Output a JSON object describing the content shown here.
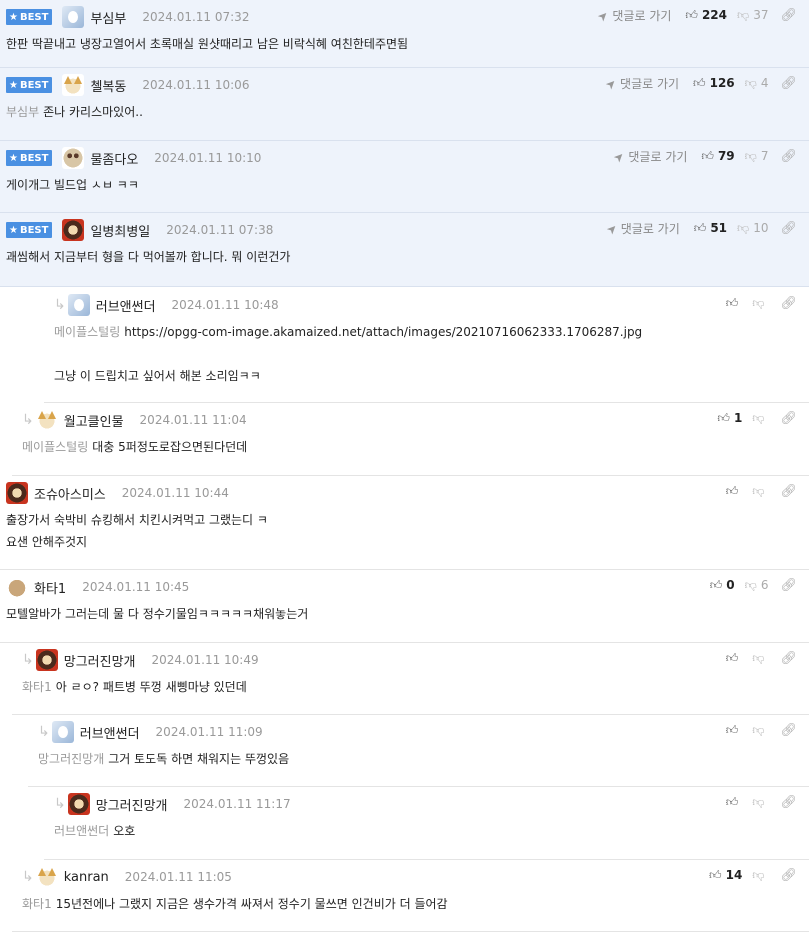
{
  "ui": {
    "best_label": "BEST",
    "goto_label": "댓글로 가기"
  },
  "comments": [
    {
      "best": true,
      "nick": "부심부",
      "time": "2024.01.11 07:32",
      "mention": "",
      "text": "한판 딱끝내고 냉장고열어서 초록매실 원샷때리고 남은 비락식혜 여친한테주면됨",
      "likes": "224",
      "dislikes": "37",
      "avatar": "blue-avatar-icon"
    },
    {
      "best": true,
      "nick": "첼복동",
      "time": "2024.01.11 10:06",
      "mention": "부심부",
      "text": "존나 카리스마있어..",
      "likes": "126",
      "dislikes": "4",
      "avatar": "dog-avatar-icon"
    },
    {
      "best": true,
      "nick": "물좀다오",
      "time": "2024.01.11 10:10",
      "mention": "",
      "text": "게이개그 빌드업 ㅅㅂ ㅋㅋ",
      "likes": "79",
      "dislikes": "7",
      "avatar": "owl-avatar-icon"
    },
    {
      "best": true,
      "nick": "일병최병일",
      "time": "2024.01.11 07:38",
      "mention": "",
      "text": "괘씸해서 지금부터 형을 다 먹어볼까 합니다. 뭐 이런건가",
      "likes": "51",
      "dislikes": "10",
      "avatar": "lion-avatar-icon"
    },
    {
      "best": false,
      "nick": "러브앤썬더",
      "time": "2024.01.11 10:48",
      "mention": "메이플스털링",
      "text": "https://opgg-com-image.akamaized.net/attach/images/20210716062333.1706287.jpg",
      "text2": "그냥 이 드립치고 싶어서 해본 소리임ㅋㅋ",
      "likes": "",
      "dislikes": "",
      "avatar": "blue-avatar-icon"
    },
    {
      "best": false,
      "nick": "월고클인물",
      "time": "2024.01.11 11:04",
      "mention": "메이플스털링",
      "text": "대충 5퍼정도로잡으면된다던데",
      "likes": "1",
      "dislikes": "",
      "avatar": "dog-avatar-icon"
    },
    {
      "best": false,
      "nick": "조슈아스미스",
      "time": "2024.01.11 10:44",
      "mention": "",
      "text": "출장가서 숙박비 슈킹해서 치킨시켜먹고 그랬는디 ㅋ",
      "text2": "요샌 안해주것지",
      "likes": "",
      "dislikes": "",
      "avatar": "lion-avatar-icon"
    },
    {
      "best": false,
      "nick": "화타1",
      "time": "2024.01.11 10:45",
      "mention": "",
      "text": "모텔알바가 그러는데 물 다 정수기물임ㅋㅋㅋㅋㅋ채워놓는거",
      "likes": "0",
      "dislikes": "6",
      "avatar": "ball-avatar-icon"
    },
    {
      "best": false,
      "nick": "망그러진망개",
      "time": "2024.01.11 10:49",
      "mention": "화타1",
      "text": "아 ㄹㅇ? 패트병 뚜껑 새삥마냥 있던데",
      "likes": "",
      "dislikes": "",
      "avatar": "lion-avatar-icon"
    },
    {
      "best": false,
      "nick": "러브앤썬더",
      "time": "2024.01.11 11:09",
      "mention": "망그러진망개",
      "text": "그거 토도독 하면 채워지는 뚜껑있음",
      "likes": "",
      "dislikes": "",
      "avatar": "blue-avatar-icon"
    },
    {
      "best": false,
      "nick": "망그러진망개",
      "time": "2024.01.11 11:17",
      "mention": "러브앤썬더",
      "text": "오호",
      "likes": "",
      "dislikes": "",
      "avatar": "lion-avatar-icon"
    },
    {
      "best": false,
      "nick": "kanran",
      "time": "2024.01.11 11:05",
      "mention": "화타1",
      "text": "15년전에나 그랬지 지금은 생수가격 싸져서 정수기 물쓰면 인건비가 더 들어감",
      "likes": "14",
      "dislikes": "",
      "avatar": "dog-avatar-icon"
    }
  ]
}
